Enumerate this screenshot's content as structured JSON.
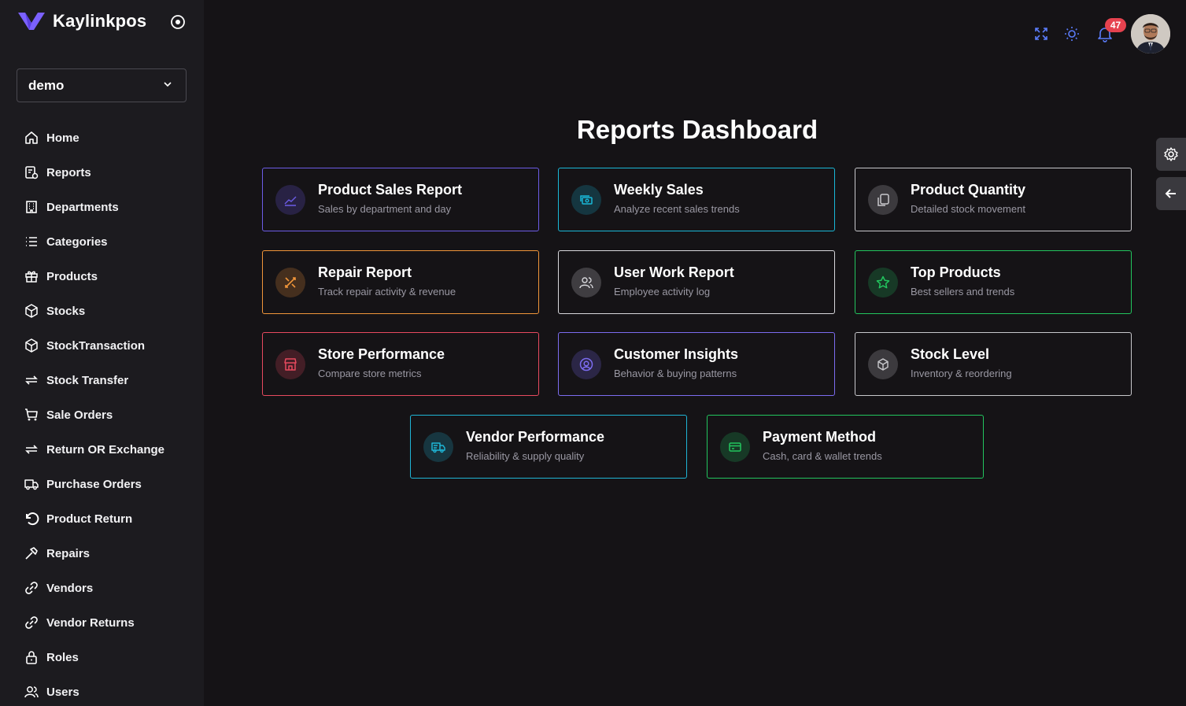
{
  "app": {
    "name": "Kaylinkpos"
  },
  "store_selector": {
    "value": "demo"
  },
  "sidebar": {
    "items": [
      {
        "label": "Home",
        "icon": "home-icon"
      },
      {
        "label": "Reports",
        "icon": "reports-icon"
      },
      {
        "label": "Departments",
        "icon": "building-icon"
      },
      {
        "label": "Categories",
        "icon": "list-icon"
      },
      {
        "label": "Products",
        "icon": "gift-icon"
      },
      {
        "label": "Stocks",
        "icon": "box-icon"
      },
      {
        "label": "StockTransaction",
        "icon": "box-icon"
      },
      {
        "label": "Stock Transfer",
        "icon": "transfer-icon"
      },
      {
        "label": "Sale Orders",
        "icon": "cart-icon"
      },
      {
        "label": "Return OR Exchange",
        "icon": "transfer-icon"
      },
      {
        "label": "Purchase Orders",
        "icon": "truck-icon"
      },
      {
        "label": "Product Return",
        "icon": "undo-icon"
      },
      {
        "label": "Repairs",
        "icon": "hammer-icon"
      },
      {
        "label": "Vendors",
        "icon": "link-icon"
      },
      {
        "label": "Vendor Returns",
        "icon": "link-icon"
      },
      {
        "label": "Roles",
        "icon": "lock-icon"
      },
      {
        "label": "Users",
        "icon": "users-icon"
      }
    ]
  },
  "topbar": {
    "notification_count": "47"
  },
  "main": {
    "title": "Reports Dashboard",
    "cards": [
      {
        "title": "Product Sales Report",
        "subtitle": "Sales by department and day",
        "color": "#6c5ce7",
        "icon": "chart-line-icon"
      },
      {
        "title": "Weekly Sales",
        "subtitle": "Analyze recent sales trends",
        "color": "#19b8d8",
        "icon": "cash-icon"
      },
      {
        "title": "Product Quantity",
        "subtitle": "Detailed stock movement",
        "color": "#c8c8cc",
        "icon": "copy-icon"
      },
      {
        "title": "Repair Report",
        "subtitle": "Track repair activity & revenue",
        "color": "#f0953a",
        "icon": "tools-icon"
      },
      {
        "title": "User Work Report",
        "subtitle": "Employee activity log",
        "color": "#d8d8dc",
        "icon": "users-icon"
      },
      {
        "title": "Top Products",
        "subtitle": "Best sellers and trends",
        "color": "#22c55e",
        "icon": "star-icon"
      },
      {
        "title": "Store Performance",
        "subtitle": "Compare store metrics",
        "color": "#e84a5f",
        "icon": "store-icon"
      },
      {
        "title": "Customer Insights",
        "subtitle": "Behavior & buying patterns",
        "color": "#7c6cf0",
        "icon": "user-circle-icon"
      },
      {
        "title": "Stock Level",
        "subtitle": "Inventory & reordering",
        "color": "#c8c8cc",
        "icon": "cube-icon"
      },
      {
        "title": "Vendor Performance",
        "subtitle": "Reliability & supply quality",
        "color": "#1fb5d6",
        "icon": "truck-icon"
      },
      {
        "title": "Payment Method",
        "subtitle": "Cash, card & wallet trends",
        "color": "#22c55e",
        "icon": "card-icon"
      }
    ]
  }
}
